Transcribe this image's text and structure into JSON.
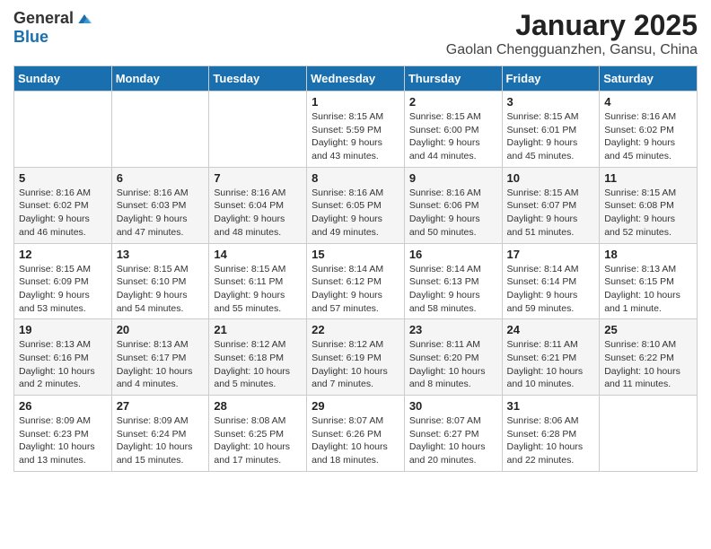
{
  "logo": {
    "general": "General",
    "blue": "Blue"
  },
  "header": {
    "month": "January 2025",
    "location": "Gaolan Chengguanzhen, Gansu, China"
  },
  "days_of_week": [
    "Sunday",
    "Monday",
    "Tuesday",
    "Wednesday",
    "Thursday",
    "Friday",
    "Saturday"
  ],
  "weeks": [
    [
      {
        "day": "",
        "info": ""
      },
      {
        "day": "",
        "info": ""
      },
      {
        "day": "",
        "info": ""
      },
      {
        "day": "1",
        "info": "Sunrise: 8:15 AM\nSunset: 5:59 PM\nDaylight: 9 hours and 43 minutes."
      },
      {
        "day": "2",
        "info": "Sunrise: 8:15 AM\nSunset: 6:00 PM\nDaylight: 9 hours and 44 minutes."
      },
      {
        "day": "3",
        "info": "Sunrise: 8:15 AM\nSunset: 6:01 PM\nDaylight: 9 hours and 45 minutes."
      },
      {
        "day": "4",
        "info": "Sunrise: 8:16 AM\nSunset: 6:02 PM\nDaylight: 9 hours and 45 minutes."
      }
    ],
    [
      {
        "day": "5",
        "info": "Sunrise: 8:16 AM\nSunset: 6:02 PM\nDaylight: 9 hours and 46 minutes."
      },
      {
        "day": "6",
        "info": "Sunrise: 8:16 AM\nSunset: 6:03 PM\nDaylight: 9 hours and 47 minutes."
      },
      {
        "day": "7",
        "info": "Sunrise: 8:16 AM\nSunset: 6:04 PM\nDaylight: 9 hours and 48 minutes."
      },
      {
        "day": "8",
        "info": "Sunrise: 8:16 AM\nSunset: 6:05 PM\nDaylight: 9 hours and 49 minutes."
      },
      {
        "day": "9",
        "info": "Sunrise: 8:16 AM\nSunset: 6:06 PM\nDaylight: 9 hours and 50 minutes."
      },
      {
        "day": "10",
        "info": "Sunrise: 8:15 AM\nSunset: 6:07 PM\nDaylight: 9 hours and 51 minutes."
      },
      {
        "day": "11",
        "info": "Sunrise: 8:15 AM\nSunset: 6:08 PM\nDaylight: 9 hours and 52 minutes."
      }
    ],
    [
      {
        "day": "12",
        "info": "Sunrise: 8:15 AM\nSunset: 6:09 PM\nDaylight: 9 hours and 53 minutes."
      },
      {
        "day": "13",
        "info": "Sunrise: 8:15 AM\nSunset: 6:10 PM\nDaylight: 9 hours and 54 minutes."
      },
      {
        "day": "14",
        "info": "Sunrise: 8:15 AM\nSunset: 6:11 PM\nDaylight: 9 hours and 55 minutes."
      },
      {
        "day": "15",
        "info": "Sunrise: 8:14 AM\nSunset: 6:12 PM\nDaylight: 9 hours and 57 minutes."
      },
      {
        "day": "16",
        "info": "Sunrise: 8:14 AM\nSunset: 6:13 PM\nDaylight: 9 hours and 58 minutes."
      },
      {
        "day": "17",
        "info": "Sunrise: 8:14 AM\nSunset: 6:14 PM\nDaylight: 9 hours and 59 minutes."
      },
      {
        "day": "18",
        "info": "Sunrise: 8:13 AM\nSunset: 6:15 PM\nDaylight: 10 hours and 1 minute."
      }
    ],
    [
      {
        "day": "19",
        "info": "Sunrise: 8:13 AM\nSunset: 6:16 PM\nDaylight: 10 hours and 2 minutes."
      },
      {
        "day": "20",
        "info": "Sunrise: 8:13 AM\nSunset: 6:17 PM\nDaylight: 10 hours and 4 minutes."
      },
      {
        "day": "21",
        "info": "Sunrise: 8:12 AM\nSunset: 6:18 PM\nDaylight: 10 hours and 5 minutes."
      },
      {
        "day": "22",
        "info": "Sunrise: 8:12 AM\nSunset: 6:19 PM\nDaylight: 10 hours and 7 minutes."
      },
      {
        "day": "23",
        "info": "Sunrise: 8:11 AM\nSunset: 6:20 PM\nDaylight: 10 hours and 8 minutes."
      },
      {
        "day": "24",
        "info": "Sunrise: 8:11 AM\nSunset: 6:21 PM\nDaylight: 10 hours and 10 minutes."
      },
      {
        "day": "25",
        "info": "Sunrise: 8:10 AM\nSunset: 6:22 PM\nDaylight: 10 hours and 11 minutes."
      }
    ],
    [
      {
        "day": "26",
        "info": "Sunrise: 8:09 AM\nSunset: 6:23 PM\nDaylight: 10 hours and 13 minutes."
      },
      {
        "day": "27",
        "info": "Sunrise: 8:09 AM\nSunset: 6:24 PM\nDaylight: 10 hours and 15 minutes."
      },
      {
        "day": "28",
        "info": "Sunrise: 8:08 AM\nSunset: 6:25 PM\nDaylight: 10 hours and 17 minutes."
      },
      {
        "day": "29",
        "info": "Sunrise: 8:07 AM\nSunset: 6:26 PM\nDaylight: 10 hours and 18 minutes."
      },
      {
        "day": "30",
        "info": "Sunrise: 8:07 AM\nSunset: 6:27 PM\nDaylight: 10 hours and 20 minutes."
      },
      {
        "day": "31",
        "info": "Sunrise: 8:06 AM\nSunset: 6:28 PM\nDaylight: 10 hours and 22 minutes."
      },
      {
        "day": "",
        "info": ""
      }
    ]
  ]
}
